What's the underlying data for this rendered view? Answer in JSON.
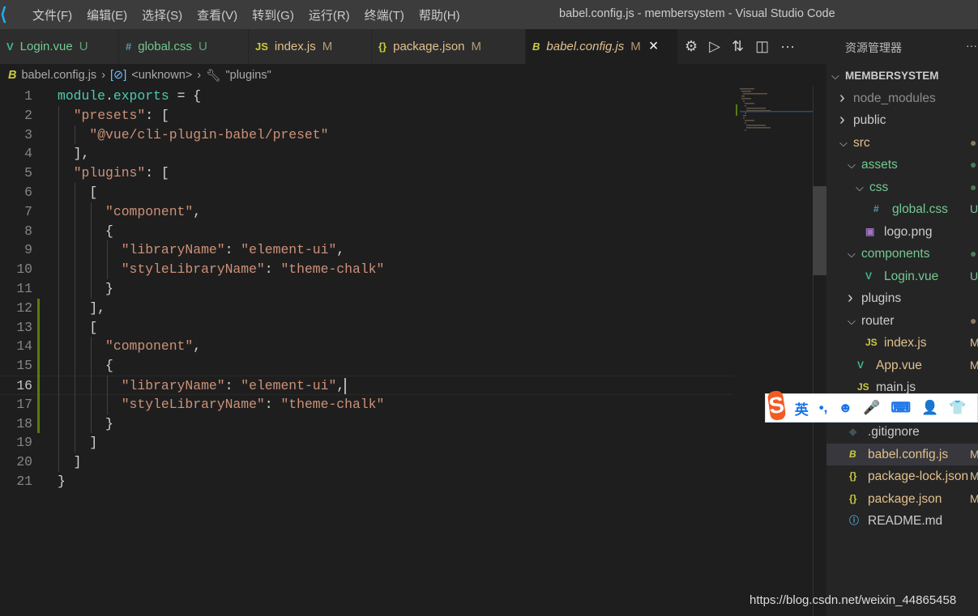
{
  "titlebar": {
    "menus": [
      "文件(F)",
      "编辑(E)",
      "选择(S)",
      "查看(V)",
      "转到(G)",
      "运行(R)",
      "终端(T)",
      "帮助(H)"
    ],
    "title": "babel.config.js - membersystem - Visual Studio Code"
  },
  "tabs": [
    {
      "icon": "V",
      "label": "Login.vue",
      "status": "U",
      "color": "#73c991",
      "icon_color": "#41b883",
      "width": 147
    },
    {
      "icon": "#",
      "label": "global.css",
      "status": "U",
      "color": "#73c991",
      "icon_color": "#519aba",
      "width": 160
    },
    {
      "icon": "JS",
      "label": "index.js",
      "status": "M",
      "color": "#e2c08d",
      "icon_color": "#cbcb41",
      "width": 152
    },
    {
      "icon": "{}",
      "label": "package.json",
      "status": "M",
      "color": "#e2c08d",
      "icon_color": "#cbcb41",
      "width": 190
    },
    {
      "icon": "B",
      "label": "babel.config.js",
      "status": "M",
      "color": "#e2c08d",
      "icon_color": "#cbcb41",
      "width": 188,
      "active": true,
      "close": "×"
    }
  ],
  "breadcrumb": {
    "file": "babel.config.js",
    "symbol": "<unknown>",
    "key": "\"plugins\""
  },
  "code": [
    [
      [
        "module",
        "#4ec9b0"
      ],
      [
        ".",
        "#d4d4d4"
      ],
      [
        "exports",
        "#4ec9b0"
      ],
      [
        " = {",
        "#d4d4d4"
      ]
    ],
    [
      [
        "  "
      ],
      [
        "\"presets\"",
        "#ce9178"
      ],
      [
        ": [",
        "#d4d4d4"
      ]
    ],
    [
      [
        "    "
      ],
      [
        "\"@vue/cli-plugin-babel/preset\"",
        "#ce9178"
      ]
    ],
    [
      [
        "  ],",
        "#d4d4d4"
      ]
    ],
    [
      [
        "  "
      ],
      [
        "\"plugins\"",
        "#ce9178"
      ],
      [
        ": [",
        "#d4d4d4"
      ]
    ],
    [
      [
        "    [",
        "#d4d4d4"
      ]
    ],
    [
      [
        "      "
      ],
      [
        "\"component\"",
        "#ce9178"
      ],
      [
        ",",
        "#d4d4d4"
      ]
    ],
    [
      [
        "      {",
        "#d4d4d4"
      ]
    ],
    [
      [
        "        "
      ],
      [
        "\"libraryName\"",
        "#ce9178"
      ],
      [
        ": ",
        "#d4d4d4"
      ],
      [
        "\"element-ui\"",
        "#ce9178"
      ],
      [
        ",",
        "#d4d4d4"
      ]
    ],
    [
      [
        "        "
      ],
      [
        "\"styleLibraryName\"",
        "#ce9178"
      ],
      [
        ": ",
        "#d4d4d4"
      ],
      [
        "\"theme-chalk\"",
        "#ce9178"
      ]
    ],
    [
      [
        "      }",
        "#d4d4d4"
      ]
    ],
    [
      [
        "    ],",
        "#d4d4d4"
      ]
    ],
    [
      [
        "    [",
        "#d4d4d4"
      ]
    ],
    [
      [
        "      "
      ],
      [
        "\"component\"",
        "#ce9178"
      ],
      [
        ",",
        "#d4d4d4"
      ]
    ],
    [
      [
        "      {",
        "#d4d4d4"
      ]
    ],
    [
      [
        "        "
      ],
      [
        "\"libraryName\"",
        "#ce9178"
      ],
      [
        ": ",
        "#d4d4d4"
      ],
      [
        "\"element-ui\"",
        "#ce9178"
      ],
      [
        ",",
        "#d4d4d4"
      ]
    ],
    [
      [
        "        "
      ],
      [
        "\"styleLibraryName\"",
        "#ce9178"
      ],
      [
        ": ",
        "#d4d4d4"
      ],
      [
        "\"theme-chalk\"",
        "#ce9178"
      ]
    ],
    [
      [
        "      }",
        "#d4d4d4"
      ]
    ],
    [
      [
        "    ]",
        "#d4d4d4"
      ]
    ],
    [
      [
        "  ]",
        "#d4d4d4"
      ]
    ],
    [
      [
        "}",
        "#d4d4d4"
      ]
    ]
  ],
  "current_line": 16,
  "sidebar": {
    "title": "资源管理器",
    "more": "···",
    "rows": [
      {
        "depth": 0,
        "twisty": "v",
        "name": "MEMBERSYSTEM",
        "color": "#cccccc",
        "bold": true
      },
      {
        "depth": 1,
        "twisty": ">",
        "name": "node_modules",
        "color": "#8c8c8c"
      },
      {
        "depth": 1,
        "twisty": ">",
        "name": "public",
        "color": "#cccccc"
      },
      {
        "depth": 1,
        "twisty": "v",
        "name": "src",
        "color": "#e2c08d",
        "badge": "●",
        "badge_color": "#8a7a62"
      },
      {
        "depth": 2,
        "twisty": "v",
        "name": "assets",
        "color": "#73c991",
        "badge": "●",
        "badge_color": "#4c7a5b"
      },
      {
        "depth": 3,
        "twisty": "v",
        "name": "css",
        "color": "#73c991",
        "badge": "●",
        "badge_color": "#4c7a5b"
      },
      {
        "depth": 4,
        "icon": "#",
        "icon_color": "#519aba",
        "name": "global.css",
        "color": "#73c991",
        "badge": "U",
        "badge_color": "#73c991"
      },
      {
        "depth": 3,
        "icon": "▣",
        "icon_color": "#a074c4",
        "name": "logo.png",
        "color": "#cccccc"
      },
      {
        "depth": 2,
        "twisty": "v",
        "name": "components",
        "color": "#73c991",
        "badge": "●",
        "badge_color": "#4c7a5b"
      },
      {
        "depth": 3,
        "icon": "V",
        "icon_color": "#41b883",
        "name": "Login.vue",
        "color": "#73c991",
        "badge": "U",
        "badge_color": "#73c991"
      },
      {
        "depth": 2,
        "twisty": ">",
        "name": "plugins",
        "color": "#cccccc"
      },
      {
        "depth": 2,
        "twisty": "v",
        "name": "router",
        "color": "#cccccc",
        "badge": "●",
        "badge_color": "#8a7a62"
      },
      {
        "depth": 3,
        "icon": "JS",
        "icon_color": "#cbcb41",
        "name": "index.js",
        "color": "#e2c08d",
        "badge": "M",
        "badge_color": "#e2c08d"
      },
      {
        "depth": 2,
        "icon": "V",
        "icon_color": "#41b883",
        "name": "App.vue",
        "color": "#e2c08d",
        "badge": "M",
        "badge_color": "#e2c08d"
      },
      {
        "depth": 2,
        "icon": "JS",
        "icon_color": "#cbcb41",
        "name": "main.js",
        "color": "#cccccc"
      },
      {
        "depth": 1,
        "icon": "",
        "icon_color": "#cccccc",
        "name": "",
        "color": "#cccccc"
      },
      {
        "depth": 1,
        "icon": "◆",
        "icon_color": "#41535b",
        "name": ".gitignore",
        "color": "#cccccc"
      },
      {
        "depth": 1,
        "icon": "B",
        "icon_color": "#cbcb41",
        "name": "babel.config.js",
        "color": "#e2c08d",
        "badge": "M",
        "badge_color": "#e2c08d",
        "selected": true
      },
      {
        "depth": 1,
        "icon": "{}",
        "icon_color": "#cbcb41",
        "name": "package-lock.json",
        "color": "#e2c08d",
        "badge": "M",
        "badge_color": "#e2c08d"
      },
      {
        "depth": 1,
        "icon": "{}",
        "icon_color": "#cbcb41",
        "name": "package.json",
        "color": "#e2c08d",
        "badge": "M",
        "badge_color": "#e2c08d"
      },
      {
        "depth": 1,
        "icon": "ⓘ",
        "icon_color": "#519aba",
        "name": "README.md",
        "color": "#cccccc"
      }
    ]
  },
  "ime": {
    "logo": "S",
    "items": [
      "英",
      "•,",
      "☻",
      "🎤",
      "⌨",
      "👤",
      "👕",
      "⋮"
    ]
  },
  "watermark": "https://blog.csdn.net/weixin_44865458"
}
